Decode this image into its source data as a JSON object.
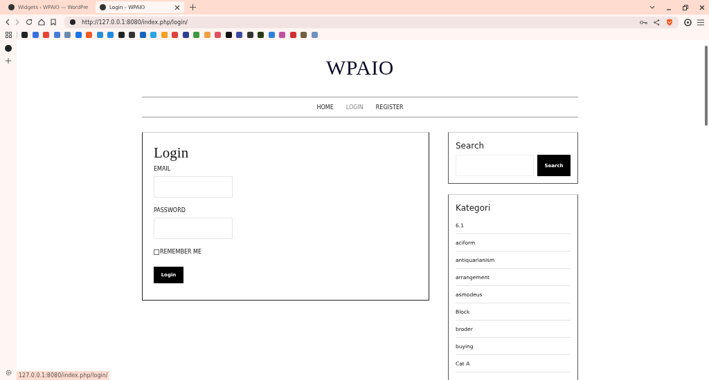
{
  "browser": {
    "tabs": [
      {
        "title": "Widgets ‹ WPAIO — WordPre",
        "selected": false
      },
      {
        "title": "Login – WPAIO",
        "selected": true
      }
    ],
    "url": "http://127.0.0.1:8080/index.php/login/",
    "bookmarks": [
      {
        "color": "#222222"
      },
      {
        "color": "#3b6fe0"
      },
      {
        "color": "#e94235"
      },
      {
        "color": "#4a7bd8"
      },
      {
        "color": "#6a8ab0"
      },
      {
        "color": "#1a73e8"
      },
      {
        "color": "#f05a28"
      },
      {
        "color": "#2a8fd0"
      },
      {
        "color": "#1e88e5"
      },
      {
        "color": "#222222"
      },
      {
        "color": "#333333"
      },
      {
        "color": "#1565c0"
      },
      {
        "color": "#29a8e0"
      },
      {
        "color": "#f4a020"
      },
      {
        "color": "#e04040"
      },
      {
        "color": "#2d3f8f"
      },
      {
        "color": "#3a9a40"
      },
      {
        "color": "#f0a040"
      },
      {
        "color": "#e05060"
      },
      {
        "color": "#111111"
      },
      {
        "color": "#3a4aa0"
      },
      {
        "color": "#333333"
      },
      {
        "color": "#2a3a1a"
      },
      {
        "color": "#2b82e0"
      },
      {
        "color": "#c050a0"
      },
      {
        "color": "#d03030"
      },
      {
        "color": "#706040"
      },
      {
        "color": "#7090c0"
      }
    ],
    "status_url": "127.0.0.1:8080/index.php/login/"
  },
  "site": {
    "title": "WPAIO",
    "nav": [
      {
        "label": "HOME",
        "selected": false
      },
      {
        "label": "LOGIN",
        "selected": true
      },
      {
        "label": "REGISTER",
        "selected": false
      }
    ]
  },
  "login": {
    "heading": "Login",
    "fields": [
      {
        "label": "EMAIL"
      },
      {
        "label": "PASSWORD"
      }
    ],
    "remember": {
      "label": "REMEMBER ME",
      "checked": false
    },
    "button": "Login"
  },
  "search_widget": {
    "title": "Search",
    "button": "Search"
  },
  "categories": {
    "title": "Kategori",
    "items": [
      "6.1",
      "aciform",
      "antiquarianism",
      "arrangement",
      "asmodeus",
      "Block",
      "broder",
      "buying",
      "Cat A"
    ]
  }
}
